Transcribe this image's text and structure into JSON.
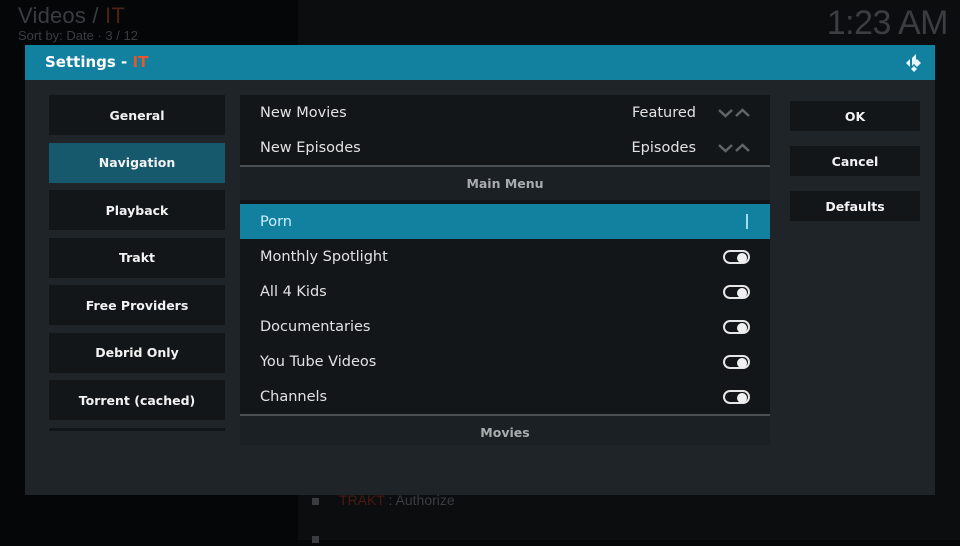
{
  "background": {
    "breadcrumb_prefix": "Videos / ",
    "breadcrumb_accent": "IT",
    "sort_info": "Sort by: Date  ·  3 / 12",
    "clock": "1:23 AM",
    "list_items": [
      {
        "accent": "TRAKT",
        "text": " : Authorize"
      },
      {
        "accent": "",
        "text": ""
      }
    ]
  },
  "dialog": {
    "title_prefix": "Settings - ",
    "title_accent": "IT",
    "logo_icon": "kodi-logo-icon",
    "accent_color": "#12809f",
    "title_accent_color": "#e8562a"
  },
  "categories": [
    {
      "label": "General",
      "active": false
    },
    {
      "label": "Navigation",
      "active": true
    },
    {
      "label": "Playback",
      "active": false
    },
    {
      "label": "Trakt",
      "active": false
    },
    {
      "label": "Free Providers",
      "active": false
    },
    {
      "label": "Debrid Only",
      "active": false
    },
    {
      "label": "Torrent (cached)",
      "active": false
    }
  ],
  "settings": {
    "spinners": [
      {
        "label": "New Movies",
        "value": "Featured"
      },
      {
        "label": "New Episodes",
        "value": "Episodes"
      }
    ],
    "sections": [
      {
        "title": "Main Menu"
      },
      {
        "title": "Movies"
      }
    ],
    "main_menu_text_item": {
      "label": "Porn",
      "value": "",
      "focused": true
    },
    "main_menu_toggles": [
      {
        "label": "Monthly Spotlight",
        "enabled": true
      },
      {
        "label": "All 4 Kids",
        "enabled": true
      },
      {
        "label": "Documentaries",
        "enabled": true
      },
      {
        "label": "You Tube Videos",
        "enabled": true
      },
      {
        "label": "Channels",
        "enabled": true
      }
    ]
  },
  "actions": {
    "ok": "OK",
    "cancel": "Cancel",
    "defaults": "Defaults"
  }
}
